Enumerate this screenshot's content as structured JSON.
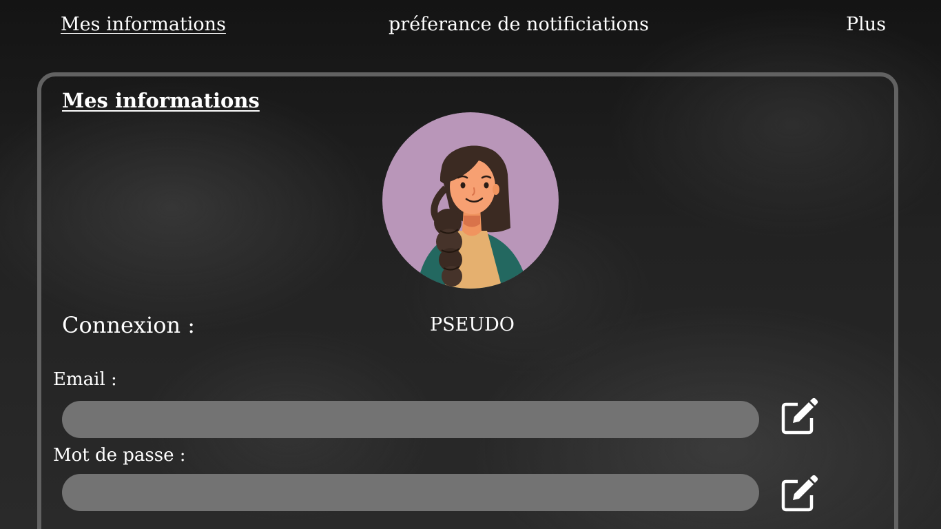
{
  "nav": {
    "items": [
      {
        "label": "Mes informations",
        "active": true
      },
      {
        "label": "préferance de notificiations",
        "active": false
      },
      {
        "label": "Plus",
        "active": false
      }
    ]
  },
  "section": {
    "title": "Mes informations",
    "avatar": {
      "icon": "user-avatar-illustration",
      "background_color": "#b996b9"
    }
  },
  "connexion": {
    "label": "Connexion :",
    "pseudo": "PSEUDO"
  },
  "fields": {
    "email": {
      "label": "Email :",
      "value": "",
      "placeholder": "",
      "edit_icon": "edit-icon"
    },
    "password": {
      "label": "Mot de passe :",
      "value": "",
      "placeholder": "",
      "edit_icon": "edit-icon"
    }
  },
  "colors": {
    "panel_border": "#626262",
    "input_fill": "#737373",
    "text": "#ffffff"
  }
}
